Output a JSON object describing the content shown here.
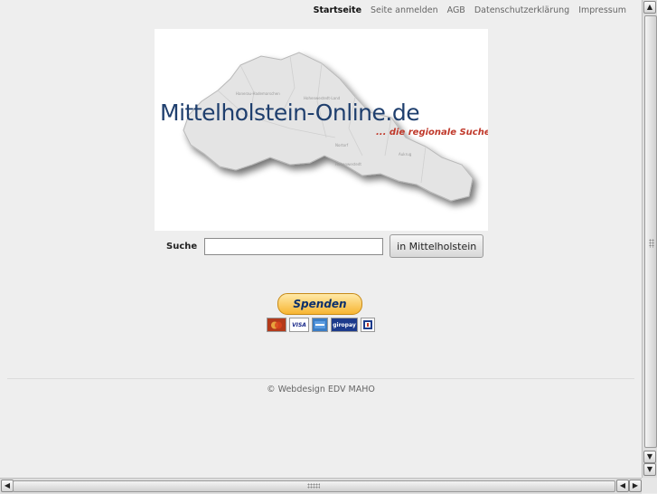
{
  "nav": {
    "items": [
      {
        "label": "Startseite",
        "active": true
      },
      {
        "label": "Seite anmelden",
        "active": false
      },
      {
        "label": "AGB",
        "active": false
      },
      {
        "label": "Datenschutzerklärung",
        "active": false
      },
      {
        "label": "Impressum",
        "active": false
      }
    ]
  },
  "banner": {
    "title": "Mittelholstein-Online.de",
    "subtitle": "... die regionale Suche"
  },
  "search": {
    "label": "Suche",
    "value": "",
    "placeholder": "",
    "button_label": "in Mittelholstein"
  },
  "donate": {
    "button_label": "Spenden",
    "cards": [
      {
        "label": "",
        "icon": "mastercard-icon",
        "bg": "#b33a1b",
        "fg": "#ffffff"
      },
      {
        "label": "VISA",
        "icon": "visa-icon",
        "bg": "#ffffff",
        "fg": "#1a2a8a"
      },
      {
        "label": "",
        "icon": "amex-icon",
        "bg": "#3a7cc4",
        "fg": "#ffffff"
      },
      {
        "label": "giropay",
        "icon": "giropay-icon",
        "bg": "#1d3b8c",
        "fg": "#ffffff"
      },
      {
        "label": "",
        "icon": "ec-icon",
        "bg": "#ffffff",
        "fg": "#c0392b"
      }
    ]
  },
  "footer": {
    "text": "© Webdesign EDV MAHO"
  },
  "colors": {
    "brand_blue": "#1f3f6e",
    "accent_red": "#c0392b",
    "page_bg": "#eeeeee"
  }
}
